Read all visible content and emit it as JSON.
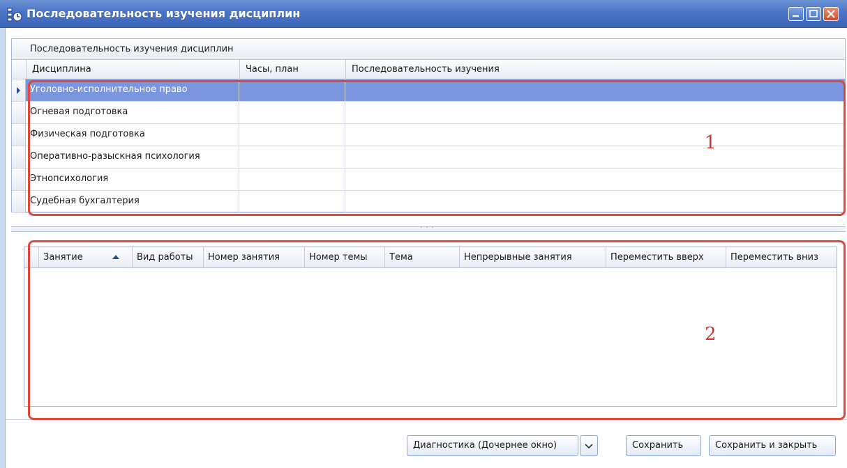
{
  "window": {
    "title": "Последовательность изучения дисциплин"
  },
  "upper_grid": {
    "caption": "Последовательность изучения дисциплин",
    "columns": [
      "Дисциплина",
      "Часы, план",
      "Последовательность изучения"
    ],
    "rows": [
      {
        "discipline": "Уголовно-исполнительное право",
        "hours": "",
        "sequence": "",
        "selected": true
      },
      {
        "discipline": "Огневая подготовка",
        "hours": "",
        "sequence": ""
      },
      {
        "discipline": "Физическая подготовка",
        "hours": "",
        "sequence": ""
      },
      {
        "discipline": "Оперативно-разыскная психология",
        "hours": "",
        "sequence": ""
      },
      {
        "discipline": "Этнопсихология",
        "hours": "",
        "sequence": ""
      },
      {
        "discipline": "Судебная бухгалтерия",
        "hours": "",
        "sequence": ""
      }
    ]
  },
  "splitter": {
    "grip": "· · ·"
  },
  "lower_grid": {
    "columns": [
      "Занятие",
      "Вид работы",
      "Номер занятия",
      "Номер темы",
      "Тема",
      "Непрерывные занятия",
      "Переместить вверх",
      "Переместить вниз"
    ]
  },
  "footer": {
    "diagnostics_label": "Диагностика (Дочернее окно)",
    "save_label": "Сохранить",
    "save_close_label": "Сохранить и закрыть"
  },
  "annotations": {
    "label_1": "1",
    "label_2": "2",
    "color": "#e0483a"
  }
}
